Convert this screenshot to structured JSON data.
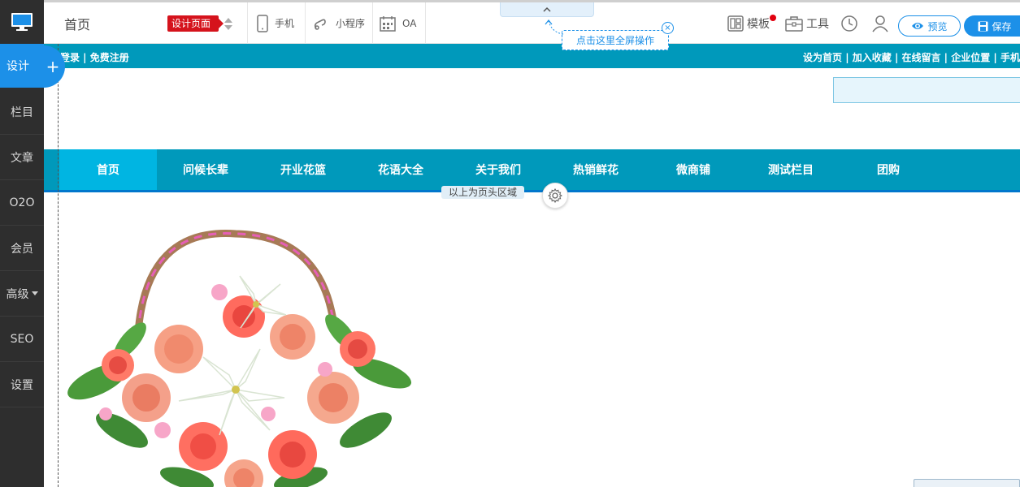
{
  "sidebar": {
    "items": [
      {
        "label": "设计"
      },
      {
        "label": "栏目"
      },
      {
        "label": "文章"
      },
      {
        "label": "O2O"
      },
      {
        "label": "会员"
      },
      {
        "label": "高级"
      },
      {
        "label": "SEO"
      },
      {
        "label": "设置"
      }
    ],
    "add_label": "+"
  },
  "toolbar": {
    "page_title": "首页",
    "badge": "设计页面",
    "tools": [
      {
        "label": "手机",
        "icon": "phone-icon"
      },
      {
        "label": "小程序",
        "icon": "mini-program-icon"
      },
      {
        "label": "OA",
        "icon": "calendar-icon"
      }
    ],
    "template_label": "模板",
    "tools_label": "工具",
    "preview_label": "预览",
    "save_label": "保存"
  },
  "fullscreen_tip": "点击这里全屏操作",
  "site": {
    "topbar": {
      "left_links": "登录 | 免费注册",
      "right_links": "设为首页 | 加入收藏 | 在线留言 | 企业位置 | 手机"
    },
    "nav": [
      "首页",
      "问候长辈",
      "开业花篮",
      "花语大全",
      "关于我们",
      "热销鲜花",
      "微商铺",
      "测试栏目",
      "团购"
    ],
    "header_note": "以上为页头区域"
  },
  "colors": {
    "accent": "#1c90e8",
    "site_primary": "#0099bb",
    "nav_active": "#00b5e2",
    "sidebar_bg": "#2e2e2e",
    "badge_red": "#d5131c"
  }
}
